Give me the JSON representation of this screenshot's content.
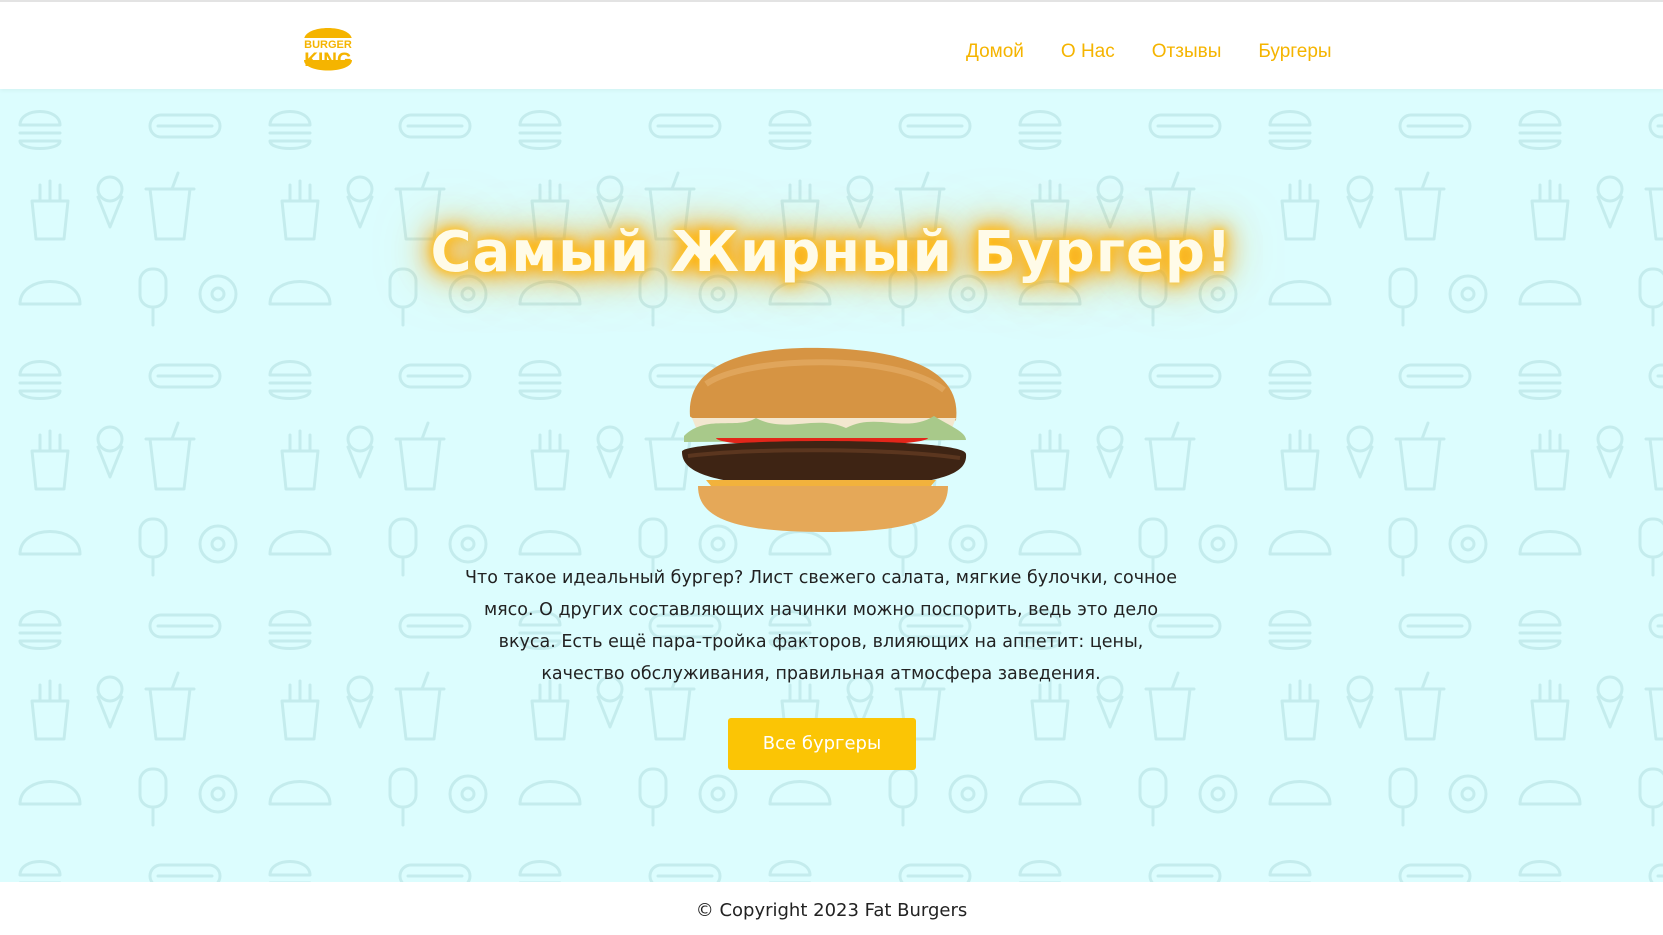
{
  "brand": {
    "logo_line1": "BURGER",
    "logo_line2": "KING",
    "color": "#f5b400"
  },
  "nav": {
    "items": [
      "Домой",
      "О Нас",
      "Отзывы",
      "Бургеры"
    ]
  },
  "hero": {
    "title": "Самый Жирный Бургер!",
    "image": "burger-photo",
    "description": "Что такое идеальный бургер? Лист свежего салата, мягкие булочки, сочное мясо. О других составляющих начинки можно поспорить, ведь это дело вкуса. Есть ещё пара-тройка факторов, влияющих на аппетит: цены, качество обслуживания, правильная атмосфера заведения.",
    "button_label": "Все бургеры",
    "background": "#dcfdfe",
    "accent": "#fbc505"
  },
  "footer": {
    "copyright": "© Copyright 2023 Fat Burgers"
  }
}
